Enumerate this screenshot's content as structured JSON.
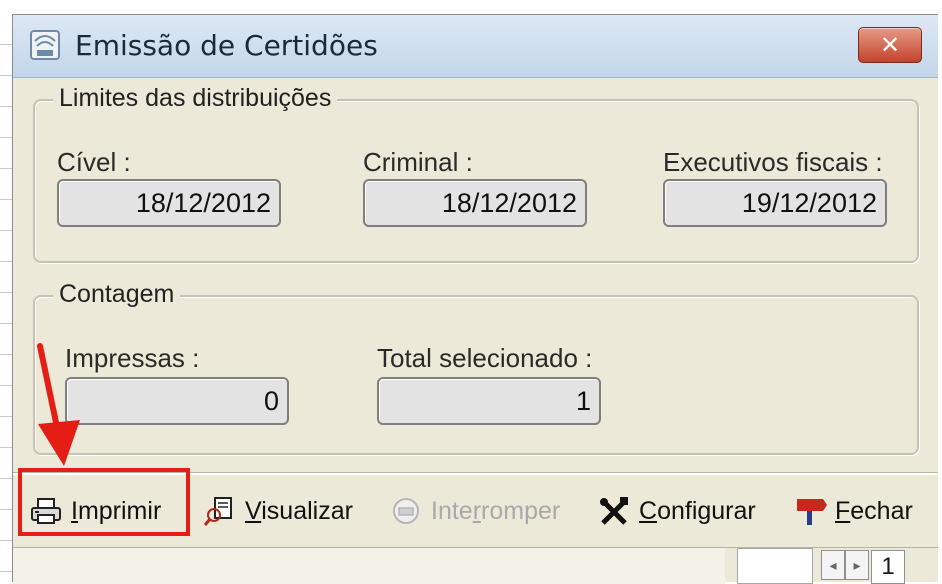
{
  "window": {
    "title": "Emissão de Certidões",
    "close_glyph": "✕",
    "app_icon": "app-seal-icon"
  },
  "distribution_limits": {
    "legend": "Limites das distribuições",
    "civel": {
      "label": "Cível :",
      "value": "18/12/2012"
    },
    "criminal": {
      "label": "Criminal :",
      "value": "18/12/2012"
    },
    "executivos": {
      "label": "Executivos fiscais :",
      "value": "19/12/2012"
    }
  },
  "count": {
    "legend": "Contagem",
    "impressas": {
      "label": "Impressas :",
      "value": "0"
    },
    "total": {
      "label": "Total selecionado :",
      "value": "1"
    }
  },
  "toolbar": {
    "imprimir": {
      "pre": "",
      "hot": "I",
      "post": "mprimir",
      "icon": "printer-icon",
      "enabled": true
    },
    "visualizar": {
      "pre": "",
      "hot": "V",
      "post": "isualizar",
      "icon": "preview-icon",
      "enabled": true
    },
    "interromper": {
      "pre": "Inte",
      "hot": "r",
      "post": "romper",
      "icon": "stop-icon",
      "enabled": false
    },
    "configurar": {
      "pre": "",
      "hot": "C",
      "post": "onfigurar",
      "icon": "tools-icon",
      "enabled": true
    },
    "fechar": {
      "pre": "",
      "hot": "F",
      "post": "echar",
      "icon": "exit-sign-icon",
      "enabled": true
    }
  },
  "statusbar": {
    "page": "1",
    "prev_glyph": "◂",
    "next_glyph": "▸"
  },
  "annotation": {
    "color": "#e41e14"
  }
}
